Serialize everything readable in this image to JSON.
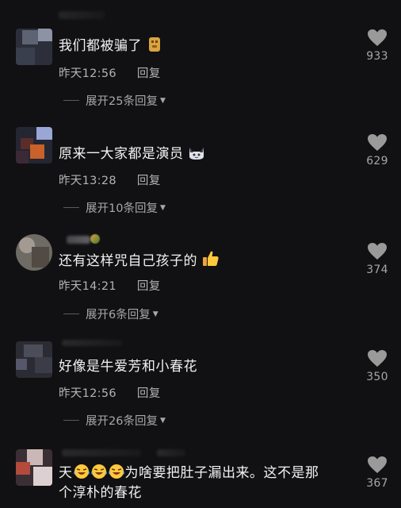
{
  "comments": [
    {
      "text": "我们都被骗了",
      "emoji": "doge",
      "time": "昨天12:56",
      "reply": "回复",
      "expand": "展开25条回复",
      "likes": "933"
    },
    {
      "text": "原来一大家都是演员",
      "emoji": "cat-face",
      "time": "昨天13:28",
      "reply": "回复",
      "expand": "展开10条回复",
      "likes": "629"
    },
    {
      "text": "还有这样咒自己孩子的",
      "emoji": "thumbs-up",
      "time": "昨天14:21",
      "reply": "回复",
      "expand": "展开6条回复",
      "likes": "374"
    },
    {
      "text": "好像是牛爱芳和小春花",
      "time": "昨天12:56",
      "reply": "回复",
      "expand": "展开26条回复",
      "likes": "350"
    },
    {
      "text_prefix": "天",
      "text_suffix": "为啥要把肚子漏出来。这不是那",
      "text_line2": "个淳朴的春花",
      "emoji": "laughing-crying",
      "likes": "367"
    }
  ],
  "colors": {
    "background": "#111113",
    "text": "#f2f2f2",
    "meta": "#b3b3b3"
  }
}
